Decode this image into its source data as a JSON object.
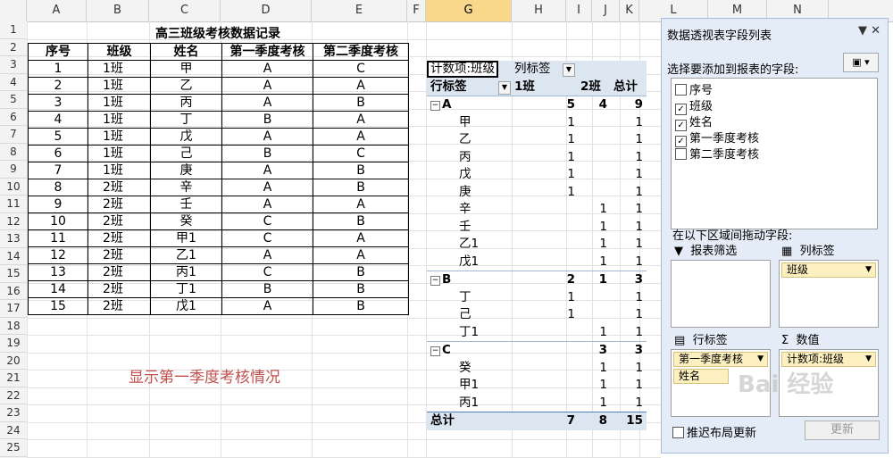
{
  "columns": [
    "A",
    "B",
    "C",
    "D",
    "E",
    "F",
    "G",
    "H",
    "I",
    "J",
    "K",
    "L",
    "M",
    "N"
  ],
  "rows": [
    "1",
    "2",
    "3",
    "4",
    "5",
    "6",
    "7",
    "8",
    "9",
    "10",
    "11",
    "12",
    "13",
    "14",
    "15",
    "16",
    "17",
    "18",
    "19",
    "20",
    "21",
    "22",
    "23",
    "24",
    "25"
  ],
  "sheet": {
    "title": "高三班级考核数据记录",
    "headers": [
      "序号",
      "班级",
      "姓名",
      "第一季度考核",
      "第二季度考核"
    ],
    "data": [
      [
        "1",
        "1班",
        "甲",
        "A",
        "C"
      ],
      [
        "2",
        "1班",
        "乙",
        "A",
        "A"
      ],
      [
        "3",
        "1班",
        "丙",
        "A",
        "B"
      ],
      [
        "4",
        "1班",
        "丁",
        "B",
        "A"
      ],
      [
        "5",
        "1班",
        "戊",
        "A",
        "A"
      ],
      [
        "6",
        "1班",
        "己",
        "B",
        "C"
      ],
      [
        "7",
        "1班",
        "庚",
        "A",
        "B"
      ],
      [
        "8",
        "2班",
        "辛",
        "A",
        "B"
      ],
      [
        "9",
        "2班",
        "壬",
        "A",
        "A"
      ],
      [
        "10",
        "2班",
        "癸",
        "C",
        "B"
      ],
      [
        "11",
        "2班",
        "甲1",
        "C",
        "A"
      ],
      [
        "12",
        "2班",
        "乙1",
        "A",
        "A"
      ],
      [
        "13",
        "2班",
        "丙1",
        "C",
        "B"
      ],
      [
        "14",
        "2班",
        "丁1",
        "B",
        "B"
      ],
      [
        "15",
        "2班",
        "戊1",
        "A",
        "B"
      ]
    ],
    "note": "显示第一季度考核情况"
  },
  "pivot": {
    "value_label": "计数项:班级",
    "col_label": "列标签",
    "row_label": "行标签",
    "col_headers": [
      "1班",
      "2班",
      "总计"
    ],
    "groups": [
      {
        "name": "A",
        "v1": "5",
        "v2": "4",
        "total": "9",
        "items": [
          [
            "甲",
            "1",
            "",
            "1"
          ],
          [
            "乙",
            "1",
            "",
            "1"
          ],
          [
            "丙",
            "1",
            "",
            "1"
          ],
          [
            "戊",
            "1",
            "",
            "1"
          ],
          [
            "庚",
            "1",
            "",
            "1"
          ],
          [
            "辛",
            "",
            "1",
            "1"
          ],
          [
            "壬",
            "",
            "1",
            "1"
          ],
          [
            "乙1",
            "",
            "1",
            "1"
          ],
          [
            "戊1",
            "",
            "1",
            "1"
          ]
        ]
      },
      {
        "name": "B",
        "v1": "2",
        "v2": "1",
        "total": "3",
        "items": [
          [
            "丁",
            "1",
            "",
            "1"
          ],
          [
            "己",
            "1",
            "",
            "1"
          ],
          [
            "丁1",
            "",
            "1",
            "1"
          ]
        ]
      },
      {
        "name": "C",
        "v1": "",
        "v2": "3",
        "total": "3",
        "items": [
          [
            "癸",
            "",
            "1",
            "1"
          ],
          [
            "甲1",
            "",
            "1",
            "1"
          ],
          [
            "丙1",
            "",
            "1",
            "1"
          ]
        ]
      }
    ],
    "total_label": "总计",
    "total": {
      "v1": "7",
      "v2": "8",
      "total": "15"
    }
  },
  "panel": {
    "title": "数据透视表字段列表",
    "choose_label": "选择要添加到报表的字段:",
    "fields": [
      {
        "name": "序号",
        "checked": false
      },
      {
        "name": "班级",
        "checked": true
      },
      {
        "name": "姓名",
        "checked": true
      },
      {
        "name": "第一季度考核",
        "checked": true
      },
      {
        "name": "第二季度考核",
        "checked": false
      }
    ],
    "drag_label": "在以下区域间拖动字段:",
    "filter_label": "报表筛选",
    "columns_label": "列标签",
    "rows_label": "行标签",
    "values_label": "数值",
    "column_chip": "班级",
    "row_chips": [
      "第一季度考核",
      "姓名"
    ],
    "value_chip": "计数项:班级",
    "defer_label": "推迟布局更新",
    "update_label": "更新",
    "watermark": "Bai 经验"
  }
}
